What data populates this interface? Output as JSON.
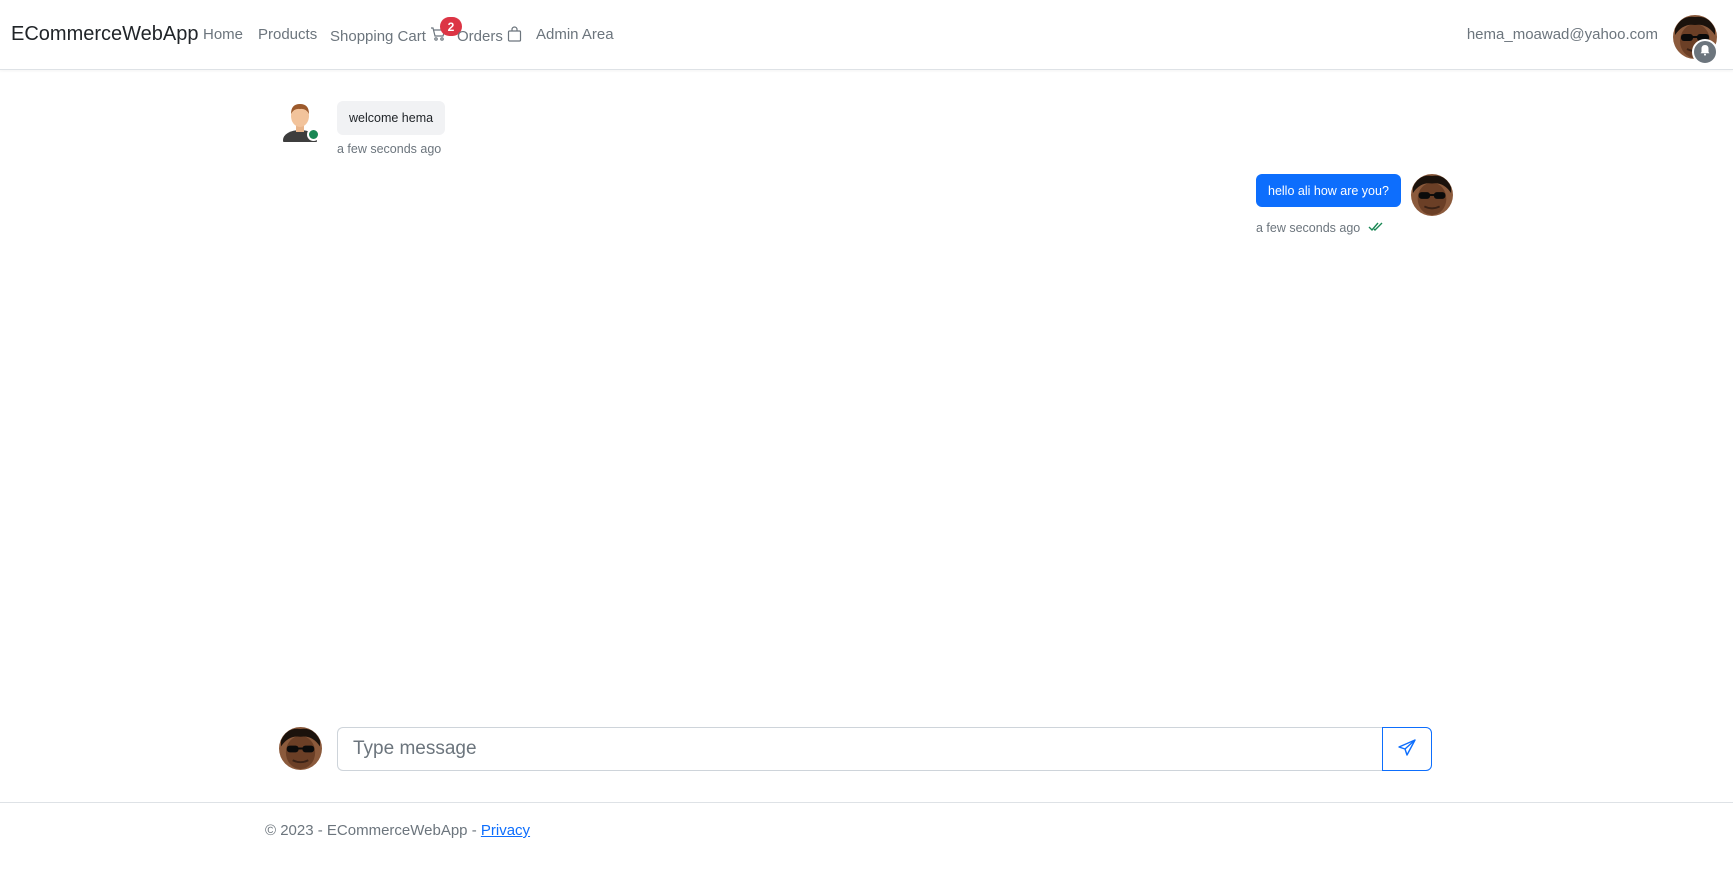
{
  "navbar": {
    "brand": "ECommerceWebApp",
    "links": {
      "home": "Home",
      "products": "Products",
      "cart": "Shopping Cart",
      "orders": "Orders",
      "admin": "Admin Area"
    },
    "cart_count": "2",
    "user_email": "hema_moawad@yahoo.com"
  },
  "chat": {
    "messages": [
      {
        "direction": "incoming",
        "text": "welcome hema",
        "time": "a few seconds ago",
        "online": true
      },
      {
        "direction": "outgoing",
        "text": "hello ali how are you?",
        "time": "a few seconds ago",
        "status": "read"
      }
    ],
    "input": {
      "placeholder": "Type message",
      "value": ""
    }
  },
  "footer": {
    "text": "© 2023 - ECommerceWebApp - ",
    "privacy": "Privacy"
  },
  "colors": {
    "accent": "#0d6efd",
    "badge": "#dc3545",
    "online": "#198754",
    "read_check": "#198754"
  }
}
